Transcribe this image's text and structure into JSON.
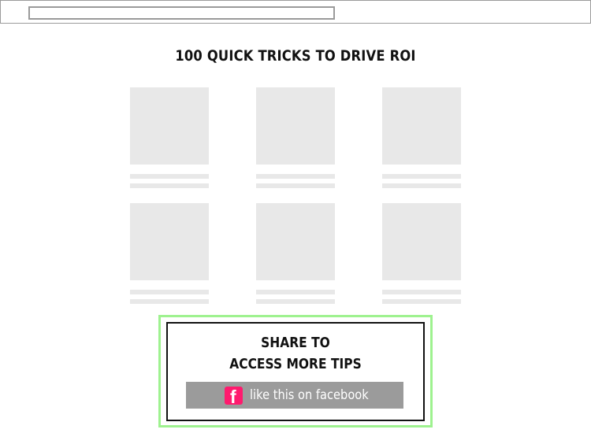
{
  "page": {
    "title": "100 QUICK TRICKS TO DRIVE ROI"
  },
  "cards": [
    {
      "id": 1
    },
    {
      "id": 2
    },
    {
      "id": 3
    },
    {
      "id": 4
    },
    {
      "id": 5
    },
    {
      "id": 6
    }
  ],
  "share": {
    "heading_line1": "SHARE TO",
    "heading_line2": "ACCESS MORE TIPS",
    "button_label": "like this on facebook",
    "icon": "facebook-icon",
    "icon_glyph": "f"
  },
  "colors": {
    "highlight": "#9ef28f",
    "placeholder": "#e8e8e8",
    "button": "#9b9b9b",
    "facebook_icon": "#ff1a6e"
  }
}
